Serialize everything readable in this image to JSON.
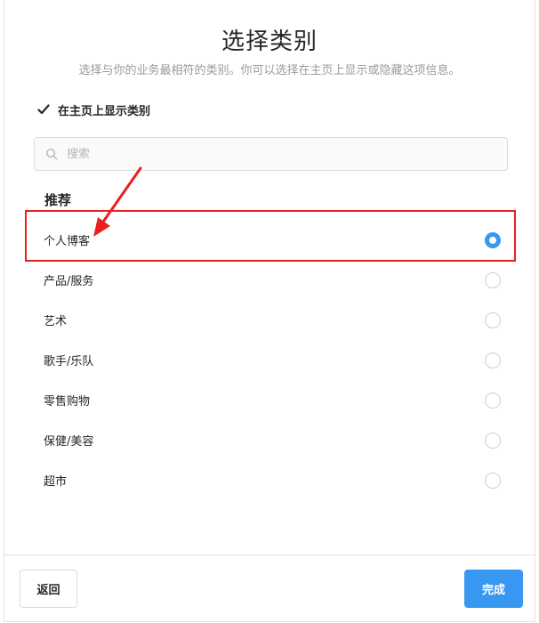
{
  "dialog": {
    "title": "选择类别",
    "subtitle": "选择与你的业务最相符的类别。你可以选择在主页上显示或隐藏这项信息。"
  },
  "show_on_profile": {
    "label": "在主页上显示类别",
    "checked": true
  },
  "search": {
    "placeholder": "搜索",
    "value": ""
  },
  "section": {
    "title": "推荐"
  },
  "categories": [
    {
      "label": "个人博客",
      "selected": true
    },
    {
      "label": "产品/服务",
      "selected": false
    },
    {
      "label": "艺术",
      "selected": false
    },
    {
      "label": "歌手/乐队",
      "selected": false
    },
    {
      "label": "零售购物",
      "selected": false
    },
    {
      "label": "保健/美容",
      "selected": false
    },
    {
      "label": "超市",
      "selected": false
    }
  ],
  "footer": {
    "back_label": "返回",
    "done_label": "完成"
  },
  "colors": {
    "accent": "#3897f0",
    "annotation": "#e8211f"
  }
}
